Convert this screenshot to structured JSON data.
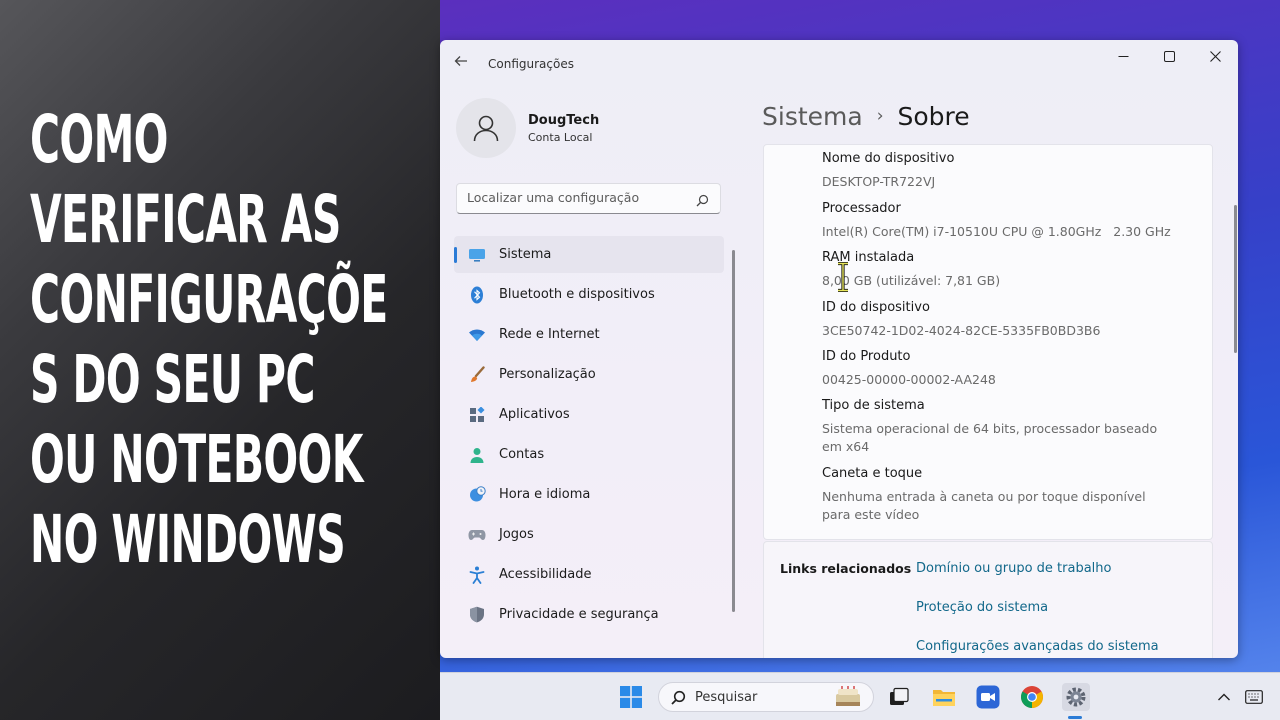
{
  "headline": {
    "lines": [
      "COMO",
      "VERIFICAR AS",
      "CONFIGURAÇÕE",
      "S DO SEU PC",
      "OU NOTEBOOK",
      "NO WINDOWS"
    ]
  },
  "window": {
    "title": "Configurações",
    "controls": {
      "minimize": "—",
      "maximize": "☐",
      "close": "✕"
    }
  },
  "profile": {
    "name": "DougTech",
    "account_type": "Conta Local"
  },
  "search": {
    "placeholder": "Localizar uma configuração"
  },
  "nav": {
    "items": [
      {
        "label": "Sistema",
        "icon": "monitor-icon",
        "active": true
      },
      {
        "label": "Bluetooth e dispositivos",
        "icon": "bluetooth-icon"
      },
      {
        "label": "Rede e Internet",
        "icon": "wifi-icon"
      },
      {
        "label": "Personalização",
        "icon": "brush-icon"
      },
      {
        "label": "Aplicativos",
        "icon": "apps-icon"
      },
      {
        "label": "Contas",
        "icon": "person-icon"
      },
      {
        "label": "Hora e idioma",
        "icon": "globe-clock-icon"
      },
      {
        "label": "Jogos",
        "icon": "gamepad-icon"
      },
      {
        "label": "Acessibilidade",
        "icon": "accessibility-icon"
      },
      {
        "label": "Privacidade e segurança",
        "icon": "shield-icon"
      }
    ]
  },
  "breadcrumb": {
    "parent": "Sistema",
    "separator": "›",
    "current": "Sobre"
  },
  "specs": [
    {
      "label": "Nome do dispositivo",
      "value": "DESKTOP-TR722VJ"
    },
    {
      "label": "Processador",
      "value": "Intel(R) Core(TM) i7-10510U CPU @ 1.80GHz   2.30 GHz"
    },
    {
      "label": "RAM instalada",
      "value": "8,00 GB (utilizável: 7,81 GB)"
    },
    {
      "label": "ID do dispositivo",
      "value": "3CE50742-1D02-4024-82CE-5335FB0BD3B6"
    },
    {
      "label": "ID do Produto",
      "value": "00425-00000-00002-AA248"
    },
    {
      "label": "Tipo de sistema",
      "value": "Sistema operacional de 64 bits, processador baseado em x64"
    },
    {
      "label": "Caneta e toque",
      "value": "Nenhuma entrada à caneta ou por toque disponível para este vídeo"
    }
  ],
  "related": {
    "title": "Links relacionados",
    "links": [
      "Domínio ou grupo de trabalho",
      "Proteção do sistema",
      "Configurações avançadas do sistema"
    ]
  },
  "taskbar": {
    "search_label": "Pesquisar",
    "apps": [
      "windows-start-icon",
      "search-icon",
      "widget-icon",
      "task-view-icon",
      "file-explorer-icon",
      "teams-meet-icon",
      "chrome-icon",
      "settings-gear-icon"
    ]
  },
  "colors": {
    "accent": "#2b7bd6",
    "link": "#12688a"
  }
}
